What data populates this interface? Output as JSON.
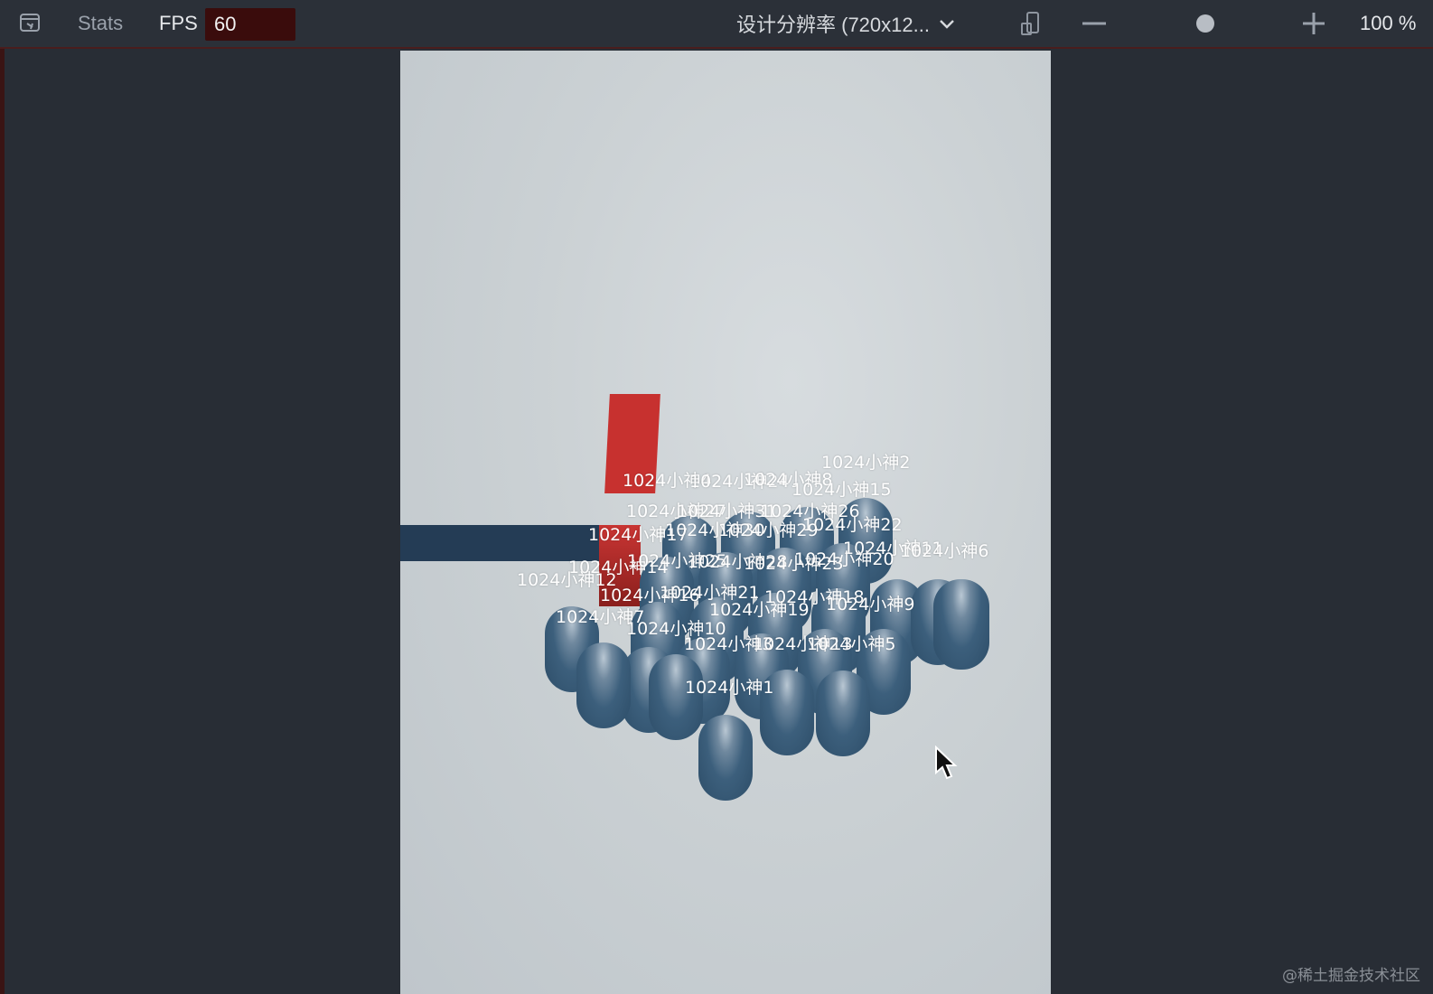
{
  "toolbar": {
    "stats_label": "Stats",
    "fps_label": "FPS",
    "fps_value": "60",
    "resolution_label": "设计分辨率 (720x12...",
    "zoom_label": "100 %",
    "icons": [
      "preview-toggle-icon",
      "chevron-down-icon",
      "rotate-device-icon",
      "zoom-out-icon",
      "zoom-slider-thumb-icon",
      "zoom-in-icon"
    ]
  },
  "scene": {
    "player_labels": [
      "1024小神2",
      "1024小神4",
      "1024小神24",
      "1024小神8",
      "1024小神15",
      "1024小神27",
      "1024小神31",
      "1024小神26",
      "1024小神22",
      "1024小神17",
      "1024小神30",
      "1024小神29",
      "1024小神11",
      "1024小神6",
      "1024小神14",
      "1024小神25",
      "1024小神28",
      "1024小神23",
      "1024小神20",
      "1024小神12",
      "1024小神16",
      "1024小神21",
      "1024小神18",
      "1024小神19",
      "1024小神9",
      "1024小神7",
      "1024小神10",
      "1024小神3",
      "1024小神13",
      "1024小神5",
      "1024小神1"
    ],
    "colors": {
      "capsule": "#3c5f7c",
      "wall": "#c7312f",
      "beam": "#243c55",
      "background": "#cbd1d4"
    }
  },
  "watermark": "@稀土掘金技术社区"
}
